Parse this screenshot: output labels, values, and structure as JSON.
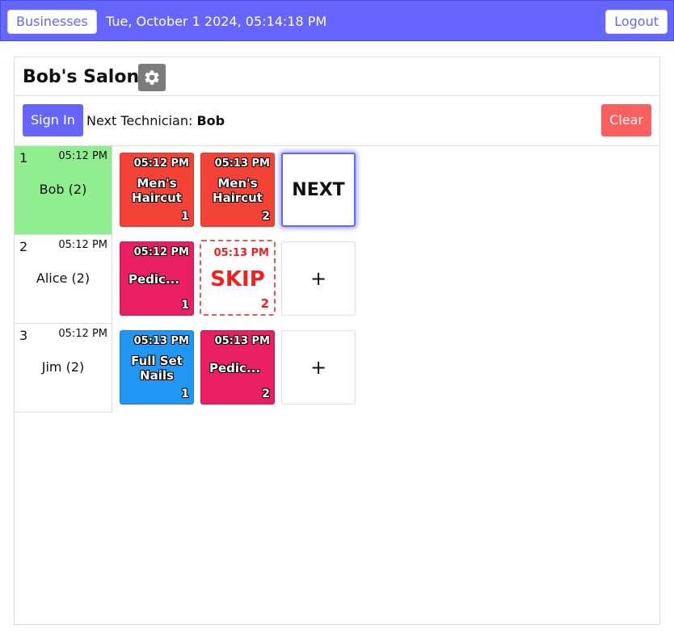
{
  "topbar": {
    "businesses_label": "Businesses",
    "datetime": "Tue, October 1 2024, 05:14:18 PM",
    "logout_label": "Logout"
  },
  "salon": {
    "name": "Bob's Salon",
    "settings_icon": "gear-icon"
  },
  "actions": {
    "signin_label": "Sign In",
    "next_tech_prefix": "Next Technician: ",
    "next_tech_name": "Bob",
    "clear_label": "Clear"
  },
  "technicians": [
    {
      "num": "1",
      "time": "05:12 PM",
      "name": "Bob (2)"
    },
    {
      "num": "2",
      "time": "05:12 PM",
      "name": "Alice (2)"
    },
    {
      "num": "3",
      "time": "05:12 PM",
      "name": "Jim (2)"
    }
  ],
  "tiles": {
    "bob": [
      {
        "time": "05:12 PM",
        "service": "Men's Haircut",
        "count": "1"
      },
      {
        "time": "05:13 PM",
        "service": "Men's Haircut",
        "count": "2"
      }
    ],
    "bob_next_label": "NEXT",
    "alice": [
      {
        "time": "05:12 PM",
        "service": "Pedic...",
        "count": "1"
      }
    ],
    "alice_skip": {
      "time": "05:13 PM",
      "label": "SKIP",
      "count": "2"
    },
    "jim": [
      {
        "time": "05:13 PM",
        "service": "Full Set Nails",
        "count": "1"
      },
      {
        "time": "05:13 PM",
        "service": "Pedic...",
        "count": "2"
      }
    ],
    "add_label": "+"
  },
  "colors": {
    "accent": "#6666ff",
    "clear": "#fb6060",
    "active_row": "#90ee90",
    "haircut": "#f44336",
    "pedicure": "#e91e63",
    "nails": "#2196f3"
  }
}
